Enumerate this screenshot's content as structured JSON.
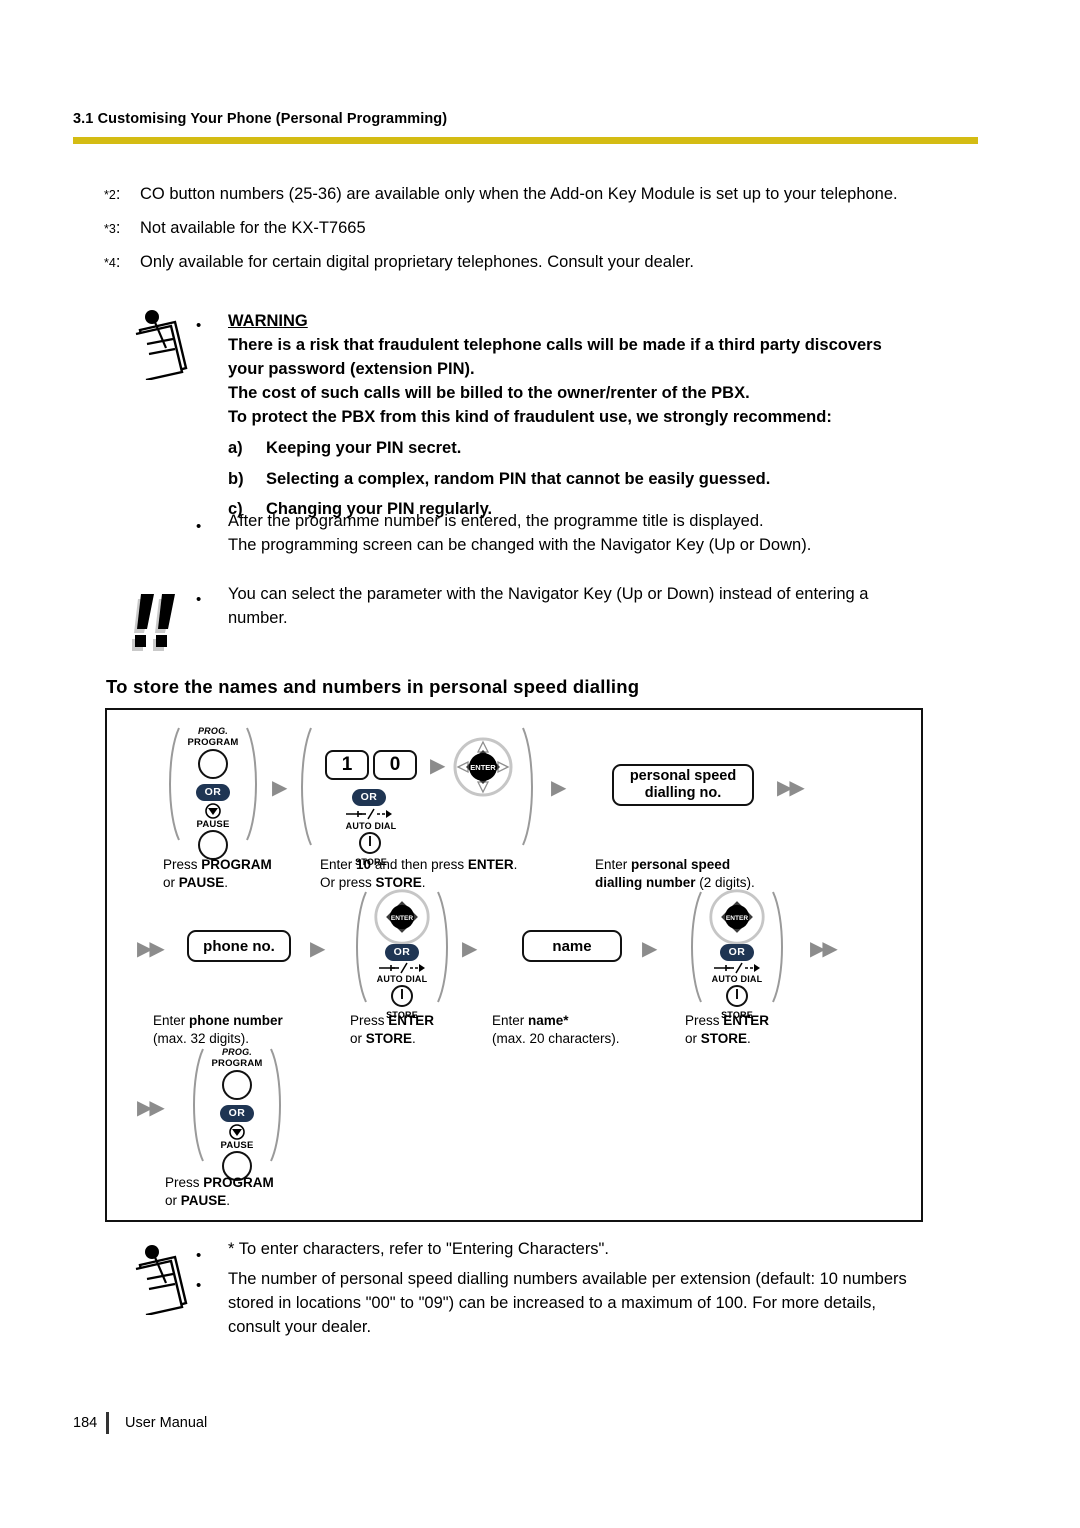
{
  "header": {
    "section_title": "3.1 Customising Your Phone (Personal Programming)",
    "rule_color": "#D4BC13"
  },
  "footnotes": [
    {
      "marker": "*2",
      "colon": ":",
      "text": "CO button numbers (25-36) are available only when the Add-on Key Module is set up to your telephone."
    },
    {
      "marker": "*3",
      "colon": ":",
      "text": "Not available for the KX-T7665"
    },
    {
      "marker": "*4",
      "colon": ":",
      "text": "Only available for certain digital proprietary telephones. Consult your dealer."
    }
  ],
  "warning": {
    "icon": "memo-pad-icon",
    "bullet": "•",
    "title": "WARNING",
    "lines": [
      "There is a risk that fraudulent telephone calls will be made if a third party discovers",
      "your password (extension PIN).",
      "The cost of such calls will be billed to the owner/renter of the PBX.",
      "To protect the PBX from this kind of fraudulent use, we strongly recommend:"
    ],
    "items": [
      {
        "label": "a)",
        "text": "Keeping your PIN secret."
      },
      {
        "label": "b)",
        "text": "Selecting a complex, random PIN that cannot be easily guessed."
      },
      {
        "label": "c)",
        "text": "Changing your PIN regularly."
      }
    ]
  },
  "note_after_warning": {
    "bullet": "•",
    "lines": [
      "After the programme number is entered, the programme title is displayed.",
      "The programming screen can be changed with the Navigator Key (Up or Down)."
    ]
  },
  "note_bang": {
    "icon": "double-exclamation-icon",
    "bullet": "•",
    "lines": [
      "You can select the parameter with the Navigator Key (Up or Down) instead of entering a",
      "number."
    ]
  },
  "section_heading": "To store the names and numbers in personal speed dialling",
  "flow": {
    "arrow_single": "▶",
    "arrow_double": "▶▶",
    "or_badge": "OR",
    "steps": [
      {
        "id": "press-program-or-pause-1",
        "type": "key-group",
        "top_label_italic": "PROG.",
        "top_label": "PROGRAM",
        "or": "OR",
        "bottom_label": "PAUSE",
        "caption_lines": [
          "Press PROGRAM",
          "or PAUSE."
        ]
      },
      {
        "id": "enter-10-then-enter",
        "type": "digits-enter-store",
        "digits": [
          "1",
          "0"
        ],
        "or": "OR",
        "enter_label": "ENTER",
        "auto_dial_label": "AUTO DIAL",
        "store_label": "STORE",
        "caption_lines": [
          "Enter 10 and then press ENTER.",
          "Or press STORE."
        ]
      },
      {
        "id": "personal-speed-dialling-no",
        "type": "display",
        "display_lines": [
          "personal speed",
          "dialling no."
        ],
        "caption_lines": [
          "Enter personal speed",
          "dialling number (2 digits)."
        ]
      },
      {
        "id": "phone-no",
        "type": "display",
        "display_lines": [
          "phone no."
        ],
        "caption_lines": [
          "Enter phone number",
          "(max. 32 digits)."
        ]
      },
      {
        "id": "press-enter-or-store-1",
        "type": "enter-store",
        "or": "OR",
        "enter_label": "ENTER",
        "auto_dial_label": "AUTO DIAL",
        "store_label": "STORE",
        "caption_lines": [
          "Press ENTER",
          "or STORE."
        ]
      },
      {
        "id": "name",
        "type": "display",
        "display_lines": [
          "name"
        ],
        "caption_lines": [
          "Enter name*",
          "(max. 20 characters)."
        ]
      },
      {
        "id": "press-enter-or-store-2",
        "type": "enter-store",
        "or": "OR",
        "enter_label": "ENTER",
        "auto_dial_label": "AUTO DIAL",
        "store_label": "STORE",
        "caption_lines": [
          "Press ENTER",
          "or STORE."
        ]
      },
      {
        "id": "press-program-or-pause-2",
        "type": "key-group",
        "top_label_italic": "PROG.",
        "top_label": "PROGRAM",
        "or": "OR",
        "bottom_label": "PAUSE",
        "caption_lines": [
          "Press PROGRAM",
          "or PAUSE."
        ]
      }
    ],
    "captions": {
      "c1a": "Press ",
      "c1b": "PROGRAM",
      "c1c": "or ",
      "c1d": "PAUSE",
      "c1e": ".",
      "c2a": "Enter ",
      "c2b": "10",
      "c2c": " and then press ",
      "c2d": "ENTER",
      "c2e": ".",
      "c2f": "Or press ",
      "c2g": "STORE",
      "c2h": ".",
      "c3a": "Enter ",
      "c3b": "personal speed",
      "c3c": "dialling number",
      "c3d": " (2 digits).",
      "c4a": "Enter ",
      "c4b": "phone number",
      "c4c": "(max. 32 digits).",
      "c5a": "Press ",
      "c5b": "ENTER",
      "c5c": "or ",
      "c5d": "STORE",
      "c5e": ".",
      "c6a": "Enter ",
      "c6b": "name*",
      "c6c": "(max. 20 characters).",
      "c7a": "Press ",
      "c7b": "ENTER",
      "c7c": "or ",
      "c7d": "STORE",
      "c7e": ".",
      "c8a": "Press ",
      "c8b": "PROGRAM",
      "c8c": "or ",
      "c8d": "PAUSE",
      "c8e": "."
    }
  },
  "bottom_notes": {
    "icon": "memo-pad-icon",
    "bullet": "•",
    "note1": "* To enter characters, refer to \"Entering Characters\".",
    "note2_lines": [
      "The number of personal speed dialling numbers available per extension (default: 10 numbers",
      "stored in locations \"00\" to \"09\") can be increased to a maximum of 100. For more details,",
      "consult your dealer."
    ]
  },
  "page_footer": {
    "page_number": "184",
    "label": "User Manual"
  }
}
